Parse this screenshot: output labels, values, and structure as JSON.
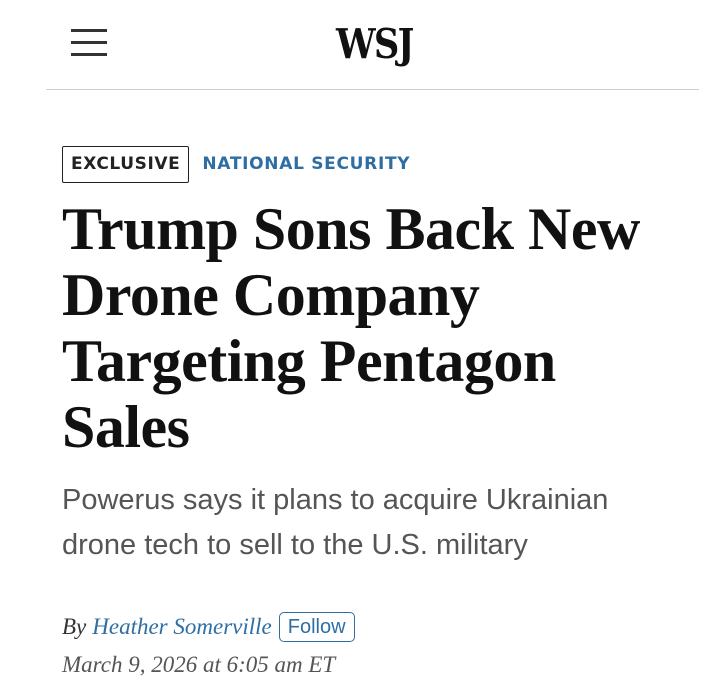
{
  "header": {
    "logo_text": "WSJ",
    "menu_icon": "hamburger-menu-icon"
  },
  "article": {
    "tag_exclusive": "EXCLUSIVE",
    "section": "NATIONAL SECURITY",
    "headline": "Trump Sons Back New Drone Company Targeting Pentagon Sales",
    "dek": "Powerus says it plans to acquire Ukrainian drone tech to sell to the U.S. military",
    "byline_prefix": "By",
    "author": "Heather Somerville",
    "follow_label": "Follow",
    "timestamp": "March 9, 2026 at 6:05 am ET"
  },
  "colors": {
    "accent_blue": "#2f6ea3",
    "headline_black": "#111111",
    "dek_gray": "#555555"
  }
}
